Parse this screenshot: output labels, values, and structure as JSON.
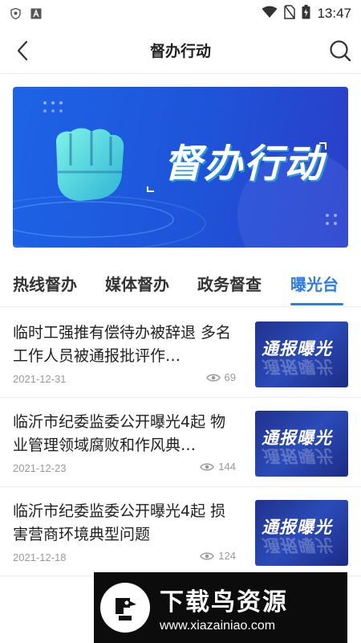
{
  "status_bar": {
    "time": "13:47",
    "left_icons": [
      "shield-icon",
      "letter-a-icon"
    ],
    "right_icons": [
      "wifi-icon",
      "no-sim-icon",
      "battery-icon"
    ]
  },
  "header": {
    "title": "督办行动",
    "back_icon": "chevron-left-icon",
    "search_icon": "search-icon"
  },
  "banner": {
    "title": "督办行动",
    "colors": {
      "start": "#1e63e6",
      "end": "#2a3ec7",
      "accent": "#3ed6e6"
    }
  },
  "tabs": [
    {
      "label": "热线督办",
      "active": false
    },
    {
      "label": "媒体督办",
      "active": false
    },
    {
      "label": "政务督查",
      "active": false
    },
    {
      "label": "曝光台",
      "active": true
    }
  ],
  "news": [
    {
      "title": "临时工强推有偿待办被辞退 多名工作人员被通报批评作…",
      "date": "2021-12-31",
      "views": "69",
      "thumb_label": "通报曝光"
    },
    {
      "title": "临沂市纪委监委公开曝光4起 物业管理领域腐败和作风典…",
      "date": "2021-12-23",
      "views": "144",
      "thumb_label": "通报曝光"
    },
    {
      "title": "临沂市纪委监委公开曝光4起 损害营商环境典型问题",
      "date": "2021-12-18",
      "views": "124",
      "thumb_label": "通报曝光"
    }
  ],
  "watermark": {
    "title": "下载鸟资源",
    "url": "www.xiazainiao.com"
  },
  "colors": {
    "accent": "#2f7de1",
    "text": "#222222",
    "meta": "#9a9a9a"
  }
}
